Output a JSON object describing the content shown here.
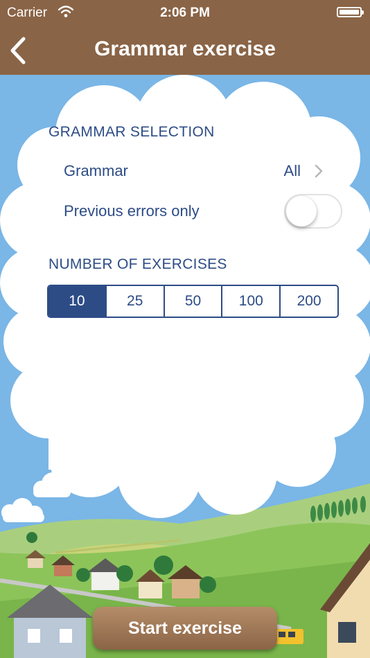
{
  "status_bar": {
    "carrier": "Carrier",
    "time": "2:06 PM"
  },
  "nav": {
    "title": "Grammar exercise",
    "back_icon": "chevron-left-icon"
  },
  "grammar_selection": {
    "header": "GRAMMAR SELECTION",
    "grammar_label": "Grammar",
    "grammar_value": "All",
    "previous_errors_label": "Previous errors only",
    "previous_errors_on": false
  },
  "number_of_exercises": {
    "header": "NUMBER OF EXERCISES",
    "options": [
      "10",
      "25",
      "50",
      "100",
      "200"
    ],
    "selected": "10"
  },
  "start_button": {
    "label": "Start exercise"
  },
  "colors": {
    "nav_brown": "#8a6446",
    "text_blue": "#2d4c86",
    "sky": "#7ab6e6",
    "grass": "#8cc45a"
  }
}
